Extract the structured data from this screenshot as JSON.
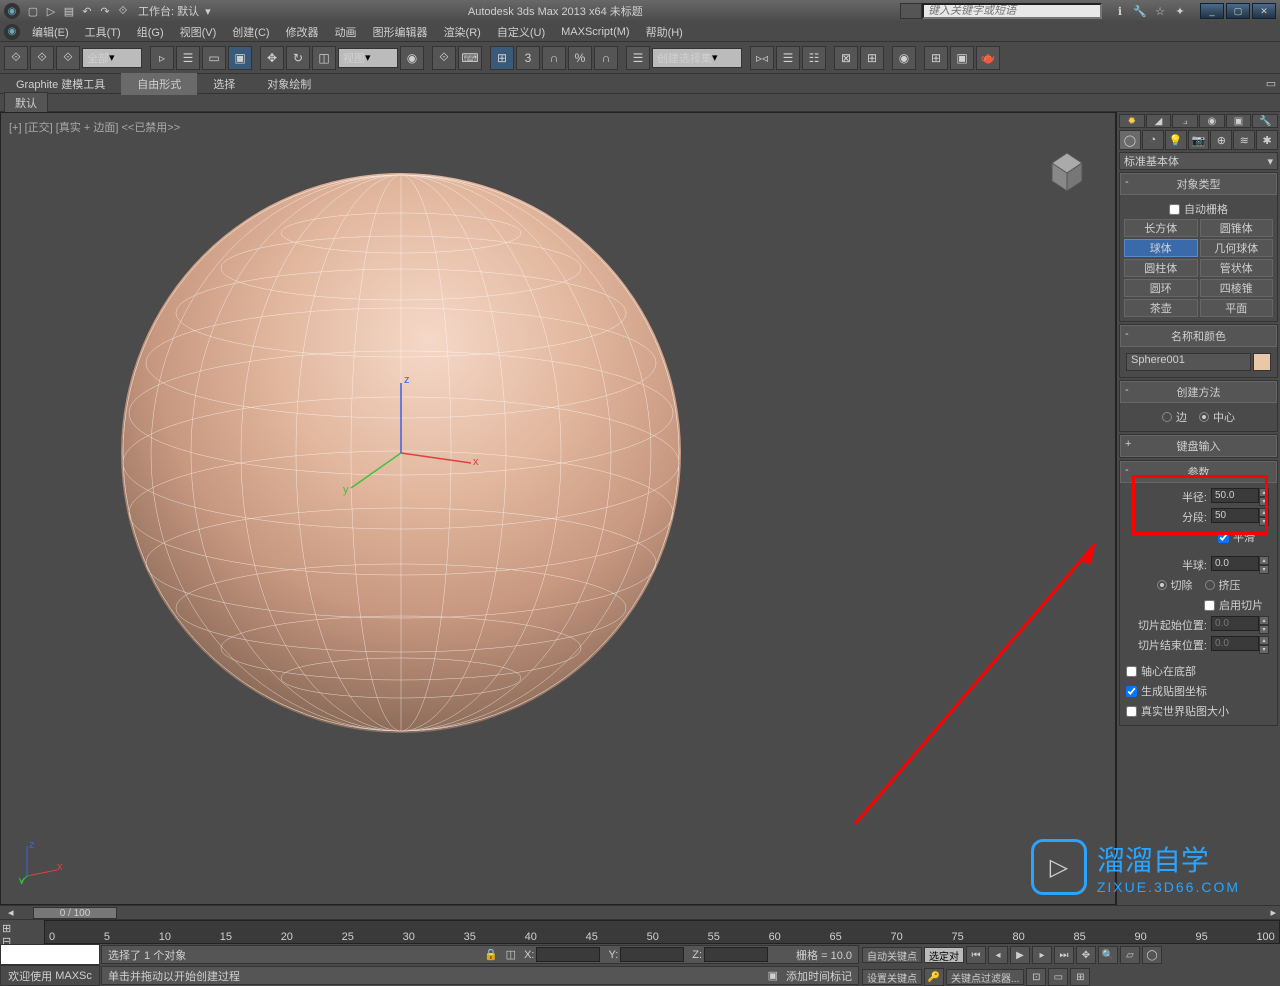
{
  "titlebar": {
    "workspace": "工作台: 默认",
    "app_title": "Autodesk 3ds Max  2013 x64    未标题",
    "search_placeholder": "键入关键字或短语"
  },
  "menus": [
    "编辑(E)",
    "工具(T)",
    "组(G)",
    "视图(V)",
    "创建(C)",
    "修改器",
    "动画",
    "图形编辑器",
    "渲染(R)",
    "自定义(U)",
    "MAXScript(M)",
    "帮助(H)"
  ],
  "toolbar": {
    "selection_filter": "全部",
    "view_dd": "视图",
    "named_sel": "创建选择集"
  },
  "ribbon": {
    "tabs": [
      "Graphite 建模工具",
      "自由形式",
      "选择",
      "对象绘制"
    ],
    "sub": "默认"
  },
  "viewport": {
    "label": "[+] [正交] [真实 + 边面]  <<已禁用>>"
  },
  "panel": {
    "primitive_dd": "标准基本体",
    "rollouts": {
      "object_type": "对象类型",
      "auto_grid": "自动栅格",
      "primitives": [
        "长方体",
        "圆锥体",
        "球体",
        "几何球体",
        "圆柱体",
        "管状体",
        "圆环",
        "四棱锥",
        "茶壶",
        "平面"
      ],
      "name_color": "名称和颜色",
      "object_name": "Sphere001",
      "creation_method": "创建方法",
      "method_edge": "边",
      "method_center": "中心",
      "keyboard_entry": "键盘输入",
      "parameters": "参数",
      "radius_label": "半径:",
      "radius_val": "50.0",
      "segments_label": "分段:",
      "segments_val": "50",
      "smooth": "平滑",
      "hemisphere_label": "半球:",
      "hemisphere_val": "0.0",
      "chop": "切除",
      "squash": "挤压",
      "slice_on": "启用切片",
      "slice_from_label": "切片起始位置:",
      "slice_from_val": "0.0",
      "slice_to_label": "切片结束位置:",
      "slice_to_val": "0.0",
      "base_pivot": "轴心在底部",
      "gen_mapping": "生成贴图坐标",
      "real_world": "真实世界贴图大小"
    }
  },
  "timeline": {
    "slider": "0 / 100",
    "ticks": [
      "0",
      "5",
      "10",
      "15",
      "20",
      "25",
      "30",
      "35",
      "40",
      "45",
      "50",
      "55",
      "60",
      "65",
      "70",
      "75",
      "80",
      "85",
      "90",
      "95",
      "100"
    ]
  },
  "status": {
    "welcome": "欢迎使用",
    "maxscript": "MAXSc",
    "sel_msg": "选择了 1 个对象",
    "prompt": "单击并拖动以开始创建过程",
    "x_label": "X:",
    "y_label": "Y:",
    "z_label": "Z:",
    "grid": "栅格 = 10.0",
    "add_time_tag": "添加时间标记",
    "auto_key": "自动关键点",
    "selected": "选定对",
    "set_key": "设置关键点",
    "key_filter": "关键点过滤器..."
  },
  "watermark": {
    "brand": "溜溜自学",
    "url": "ZIXUE.3D66.COM"
  }
}
